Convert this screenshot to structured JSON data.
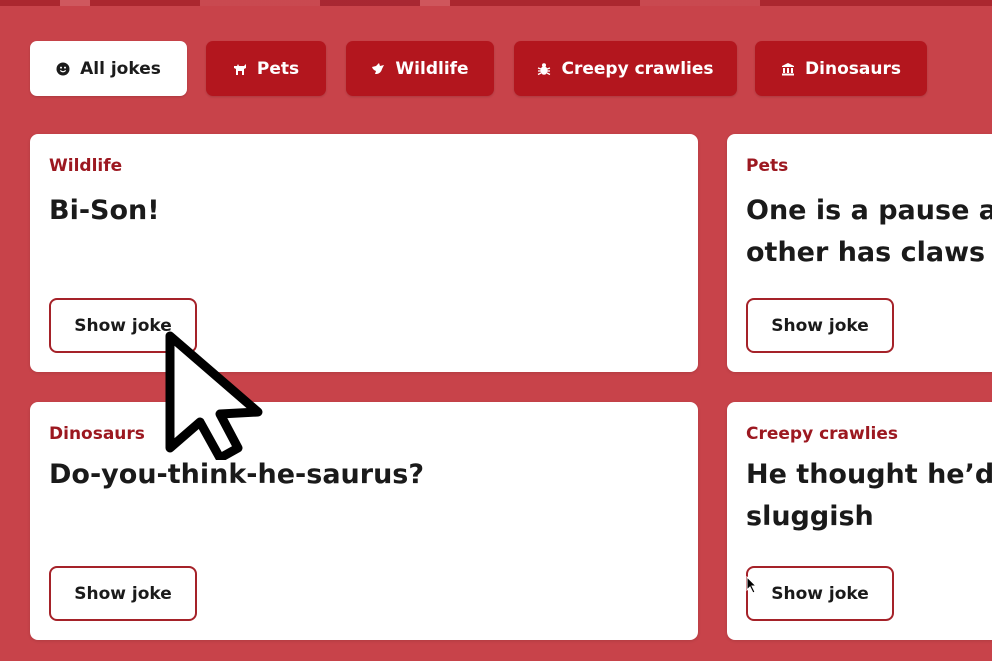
{
  "filters": [
    {
      "label": "All jokes",
      "icon": "smiley-icon",
      "active": true
    },
    {
      "label": "Pets",
      "icon": "dog-icon",
      "active": false
    },
    {
      "label": "Wildlife",
      "icon": "bird-icon",
      "active": false
    },
    {
      "label": "Creepy crawlies",
      "icon": "bug-icon",
      "active": false
    },
    {
      "label": "Dinosaurs",
      "icon": "museum-icon",
      "active": false
    }
  ],
  "cards": [
    {
      "category": "Wildlife",
      "setup_lines": [
        "Bi-Son!"
      ],
      "button": "Show joke"
    },
    {
      "category": "Pets",
      "setup_lines": [
        "One is a pause at t",
        "other has claws at"
      ],
      "button": "Show joke"
    },
    {
      "category": "Dinosaurs",
      "setup_lines": [
        "Do-you-think-he-saurus?"
      ],
      "button": "Show joke"
    },
    {
      "category": "Creepy crawlies",
      "setup_lines": [
        "He thought he’d g",
        "sluggish"
      ],
      "button": "Show joke"
    }
  ],
  "colors": {
    "background": "#c8434a",
    "chip": "#b3161e",
    "accent": "#9c1820"
  }
}
